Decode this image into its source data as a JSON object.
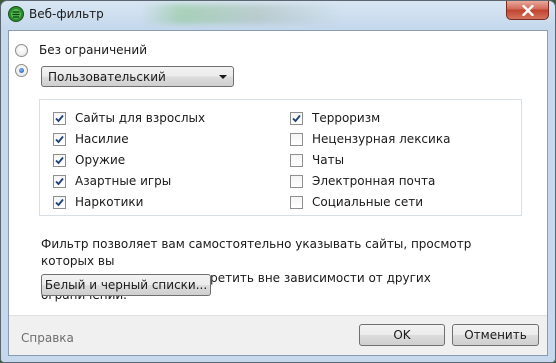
{
  "window": {
    "title": "Веб-фильтр",
    "close_icon": "close-icon",
    "app_icon": "web-filter-app-icon"
  },
  "mode": {
    "no_restrictions_label": "Без ограничений",
    "no_restrictions_selected": false,
    "custom_selected": true,
    "dropdown_value": "Пользовательский"
  },
  "categories": {
    "left": [
      {
        "label": "Сайты для взрослых",
        "checked": true
      },
      {
        "label": "Насилие",
        "checked": true
      },
      {
        "label": "Оружие",
        "checked": true
      },
      {
        "label": "Азартные игры",
        "checked": true
      },
      {
        "label": "Наркотики",
        "checked": true
      }
    ],
    "right": [
      {
        "label": "Терроризм",
        "checked": true
      },
      {
        "label": "Нецензурная лексика",
        "checked": false
      },
      {
        "label": "Чаты",
        "checked": false
      },
      {
        "label": "Электронная почта",
        "checked": false
      },
      {
        "label": "Социальные сети",
        "checked": false
      }
    ]
  },
  "description": {
    "line1": "Фильтр позволяет вам самостоятельно указывать сайты, просмотр которых вы",
    "line2": "хотите разрешить или запретить вне зависимости от других ограничений."
  },
  "lists_button": "Белый и черный списки...",
  "footer": {
    "help_link": "Справка",
    "ok_label": "OK",
    "cancel_label": "Отменить"
  }
}
